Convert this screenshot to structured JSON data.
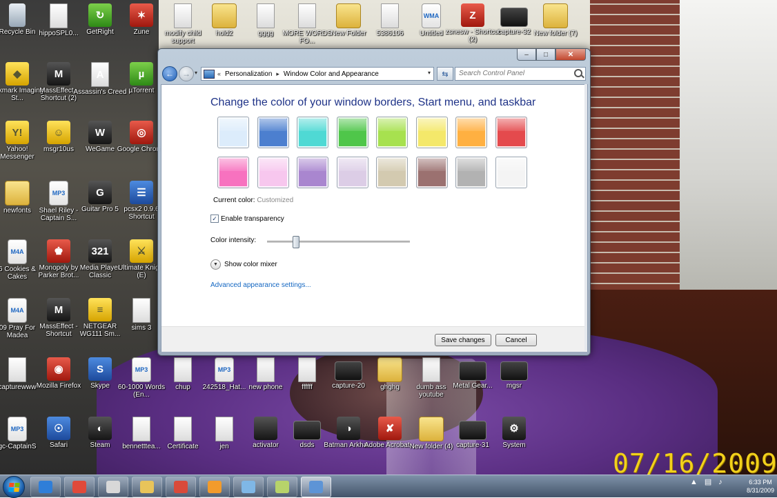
{
  "desktop": {
    "datestamp": "07/16/2009",
    "icons": [
      {
        "label": "Recycle Bin",
        "glyph": "",
        "kind": "g-bin"
      },
      {
        "label": "hippoSPL0...",
        "glyph": "",
        "kind": "g-file"
      },
      {
        "label": "GetRight",
        "glyph": "↻",
        "kind": "g-green"
      },
      {
        "label": "Zune",
        "glyph": "✶",
        "kind": "g-red"
      },
      {
        "label": "modify child support",
        "glyph": "",
        "kind": "g-file"
      },
      {
        "label": "hold2",
        "glyph": "",
        "kind": "g-folder"
      },
      {
        "label": "gggg",
        "glyph": "",
        "kind": "g-file"
      },
      {
        "label": "MORE WORDS FO...",
        "glyph": "",
        "kind": "g-file"
      },
      {
        "label": "New Folder",
        "glyph": "",
        "kind": "g-folder"
      },
      {
        "label": "5386106",
        "glyph": "",
        "kind": "g-file"
      },
      {
        "label": "Untitled",
        "glyph": "WMA",
        "kind": "g-mp3"
      },
      {
        "label": "zsnesw - Shortcut (2)",
        "glyph": "Z",
        "kind": "g-red"
      },
      {
        "label": "capture-32",
        "glyph": "",
        "kind": "g-video"
      },
      {
        "label": "New folder (7)",
        "glyph": "",
        "kind": "g-folder"
      },
      {
        "label": "Lexmark Imaging St...",
        "glyph": "◆",
        "kind": "g-yellow"
      },
      {
        "label": "MassEffect - Shortcut (2)",
        "glyph": "M",
        "kind": "g-dark"
      },
      {
        "label": "Assassin's Creed",
        "glyph": "A",
        "kind": "g-file"
      },
      {
        "label": "µTorrent",
        "glyph": "µ",
        "kind": "g-green"
      },
      {
        "label": "Yahoo! Messenger",
        "glyph": "Y!",
        "kind": "g-yellow"
      },
      {
        "label": "msgr10us",
        "glyph": "☺",
        "kind": "g-yellow"
      },
      {
        "label": "WeGame",
        "glyph": "W",
        "kind": "g-dark"
      },
      {
        "label": "Google Chrome",
        "glyph": "◎",
        "kind": "g-red"
      },
      {
        "label": "newfonts",
        "glyph": "",
        "kind": "g-folder"
      },
      {
        "label": "Shael Riley - Captain S...",
        "glyph": "MP3",
        "kind": "g-mp3"
      },
      {
        "label": "Guitar Pro 5",
        "glyph": "G",
        "kind": "g-dark"
      },
      {
        "label": "pcsx2 0.9.6 Shortcut",
        "glyph": "☰",
        "kind": "g-app"
      },
      {
        "label": "6 Cookies & Cakes",
        "glyph": "M4A",
        "kind": "g-mp3"
      },
      {
        "label": "Monopoly by Parker Brot...",
        "glyph": "♚",
        "kind": "g-red"
      },
      {
        "label": "Media Player Classic",
        "glyph": "321",
        "kind": "g-dark"
      },
      {
        "label": "Ultimate Knight (E)",
        "glyph": "⚔",
        "kind": "g-yellow"
      },
      {
        "label": "09 Pray For Madea",
        "glyph": "M4A",
        "kind": "g-mp3"
      },
      {
        "label": "MassEffect - Shortcut",
        "glyph": "M",
        "kind": "g-dark"
      },
      {
        "label": "NETGEAR WG111 Sm...",
        "glyph": "≡",
        "kind": "g-yellow"
      },
      {
        "label": "sims 3",
        "glyph": "",
        "kind": "g-file"
      },
      {
        "label": "capturewww",
        "glyph": "",
        "kind": "g-file"
      },
      {
        "label": "Mozilla Firefox",
        "glyph": "◉",
        "kind": "g-red"
      },
      {
        "label": "Skype",
        "glyph": "S",
        "kind": "g-app"
      },
      {
        "label": "60-1000 Words (En...",
        "glyph": "MP3",
        "kind": "g-mp3"
      },
      {
        "label": "gc-CaptainS",
        "glyph": "MP3",
        "kind": "g-mp3"
      },
      {
        "label": "Safari",
        "glyph": "☉",
        "kind": "g-app"
      },
      {
        "label": "Steam",
        "glyph": "◐",
        "kind": "g-dark"
      },
      {
        "label": "bennetttea...",
        "glyph": "",
        "kind": "g-file"
      },
      {
        "label": "Certificate",
        "glyph": "",
        "kind": "g-file"
      },
      {
        "label": "chup",
        "glyph": "",
        "kind": "g-file"
      },
      {
        "label": "242518_Hat...",
        "glyph": "MP3",
        "kind": "g-mp3"
      },
      {
        "label": "new phone",
        "glyph": "",
        "kind": "g-file"
      },
      {
        "label": "ffffff",
        "glyph": "",
        "kind": "g-file"
      },
      {
        "label": "capture-20",
        "glyph": "",
        "kind": "g-video"
      },
      {
        "label": "ghghg",
        "glyph": "",
        "kind": "g-folder"
      },
      {
        "label": "dumb ass youtube",
        "glyph": "",
        "kind": "g-file"
      },
      {
        "label": "Metal Gear...",
        "glyph": "",
        "kind": "g-video"
      },
      {
        "label": "mgsr",
        "glyph": "",
        "kind": "g-video"
      },
      {
        "label": "jen",
        "glyph": "",
        "kind": "g-file"
      },
      {
        "label": "activator",
        "glyph": "",
        "kind": "g-dark"
      },
      {
        "label": "dsds",
        "glyph": "",
        "kind": "g-video"
      },
      {
        "label": "Batman Arkha...",
        "glyph": "◑",
        "kind": "g-dark"
      },
      {
        "label": "Adobe Acrobat...",
        "glyph": "✘",
        "kind": "g-red"
      },
      {
        "label": "New folder (4)",
        "glyph": "",
        "kind": "g-folder"
      },
      {
        "label": "capture-31",
        "glyph": "",
        "kind": "g-video"
      },
      {
        "label": "System",
        "glyph": "⚙",
        "kind": "g-dark"
      }
    ]
  },
  "window": {
    "caption_buttons": {
      "minimize": "–",
      "maximize": "□",
      "close": "✕"
    },
    "nav": {
      "back": "←",
      "forward": "→",
      "recent": "▾",
      "refresh": "⇆"
    },
    "breadcrumb": [
      "«",
      "Personalization",
      "▸",
      "Window Color and Appearance"
    ],
    "address_dropdown": "▾",
    "search_placeholder": "Search Control Panel",
    "title": "Change the color of your window borders, Start menu, and taskbar",
    "swatches": [
      {
        "name": "sky",
        "color": "#dcecfb"
      },
      {
        "name": "twilight",
        "color": "#4c7fcf"
      },
      {
        "name": "sea",
        "color": "#4fd9d4"
      },
      {
        "name": "leaf",
        "color": "#4fc64a"
      },
      {
        "name": "lime",
        "color": "#a7e14f"
      },
      {
        "name": "lightning",
        "color": "#f4e86a"
      },
      {
        "name": "pumpkin",
        "color": "#ffb041"
      },
      {
        "name": "ruby",
        "color": "#e44a4d"
      },
      {
        "name": "fuchsia",
        "color": "#f772bf"
      },
      {
        "name": "blush",
        "color": "#f7c7ee"
      },
      {
        "name": "violet",
        "color": "#a986cf"
      },
      {
        "name": "lavender",
        "color": "#dccde6"
      },
      {
        "name": "taupe",
        "color": "#d3cab0"
      },
      {
        "name": "chocolate",
        "color": "#9b7170"
      },
      {
        "name": "slate",
        "color": "#b2b2b2"
      },
      {
        "name": "frost",
        "color": "#f4f4f4"
      }
    ],
    "current_color_label": "Current color:",
    "current_color_value": "Customized",
    "transparency_label": "Enable transparency",
    "transparency_checked": true,
    "intensity_label": "Color intensity:",
    "intensity_value": 0.2,
    "mixer_label": "Show color mixer",
    "advanced_link": "Advanced appearance settings...",
    "save_label": "Save changes",
    "cancel_label": "Cancel"
  },
  "taskbar": {
    "items": [
      {
        "name": "ie",
        "color": "#2f7ed8",
        "active": false
      },
      {
        "name": "chrome",
        "color": "#e04a3a",
        "active": false
      },
      {
        "name": "notepad",
        "color": "#d8d8d8",
        "active": false
      },
      {
        "name": "explorer",
        "color": "#e8c45a",
        "active": false
      },
      {
        "name": "zune",
        "color": "#d94a3a",
        "active": false
      },
      {
        "name": "media-player",
        "color": "#f29b2c",
        "active": false
      },
      {
        "name": "open-window-1",
        "color": "#7fb7e6",
        "active": false
      },
      {
        "name": "open-window-2",
        "color": "#b7d36a",
        "active": false
      },
      {
        "name": "control-panel",
        "color": "#5d94d6",
        "active": true
      }
    ],
    "clock_time": "6:33 PM",
    "clock_date": "8/31/2009"
  }
}
